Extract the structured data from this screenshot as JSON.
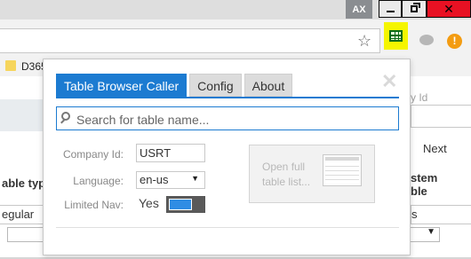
{
  "window": {
    "badge": "AX",
    "minimize_icon": "minimize-icon",
    "maximize_icon": "restore-icon",
    "close_glyph": "✕"
  },
  "toolbar": {
    "star_glyph": "☆",
    "extension_alert_glyph": "!",
    "highlight_color": "#f5f500"
  },
  "bookmarks": {
    "items": [
      {
        "label": "D365",
        "icon": "folder-icon"
      }
    ]
  },
  "background_page": {
    "company_id_label": "y Id",
    "next_label": "Next",
    "table_type_label": "able type",
    "system_label_line1": "stem",
    "system_label_line2": "ble",
    "regular_value": "egular",
    "system_value": "s"
  },
  "popup": {
    "tabs": [
      {
        "label": "Table Browser Caller",
        "active": true
      },
      {
        "label": "Config",
        "active": false
      },
      {
        "label": "About",
        "active": false
      }
    ],
    "close_glyph": "✕",
    "search": {
      "placeholder": "Search for table name...",
      "value": ""
    },
    "company_id": {
      "label": "Company Id:",
      "value": "USRT"
    },
    "language": {
      "label": "Language:",
      "value": "en-us"
    },
    "limited_nav": {
      "label": "Limited Nav:",
      "value": "Yes",
      "on": true
    },
    "open_button": {
      "line1": "Open full",
      "line2": "table list..."
    },
    "accent_color": "#1c7bd1"
  }
}
